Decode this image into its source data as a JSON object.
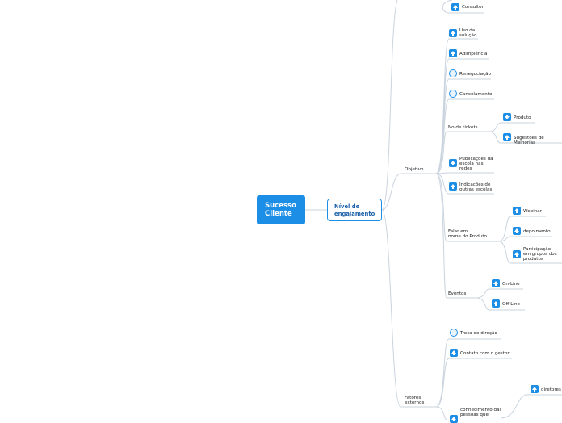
{
  "root": "Sucesso\nCliente",
  "main": "Nível de\nengajamento",
  "branches": {
    "objetivo": "Objetivo",
    "fatores": "Fatores\nexternos"
  },
  "items": {
    "consultor": "Consultor",
    "uso": "Uso da\nsolução",
    "adimplencia": "Adimplência",
    "renegociacao": "Renegociação",
    "cancelamento": "Cancelamento",
    "tickets": "No de tickets",
    "produto": "Produto",
    "sugestoes": "Sugestões de Melhorias",
    "publicacoes": "Publicações da\nescola nas\nredes",
    "indicacoes": "Indicações de\noutras escolas",
    "falar": "Falar em\nnome do Produto",
    "webinar": "Webinar",
    "depoimento": "depoimento",
    "participacao": "Participação\nem grupos dos\nprodutos",
    "eventos": "Eventos",
    "online": "On-Line",
    "offline": "Off-Line",
    "troca": "Troca de direção",
    "contato": "Contato com o gestor",
    "conhecimento": "conhecimento das\npessoas que",
    "diretores": "diretores"
  },
  "icons": {
    "consultor": "arrow-up-icon",
    "uso": "arrow-up-icon",
    "adimplencia": "arrow-up-icon",
    "renegociacao": "circle-icon",
    "cancelamento": "circle-icon",
    "produto": "arrow-down-icon",
    "sugestoes": "arrow-up-icon",
    "publicacoes": "arrow-up-icon",
    "indicacoes": "arrow-up-icon",
    "webinar": "arrow-up-icon",
    "depoimento": "arrow-up-icon",
    "participacao": "arrow-up-icon",
    "online": "arrow-up-icon",
    "offline": "arrow-up-icon",
    "troca": "circle-icon",
    "contato": "arrow-up-icon",
    "conhecimento": "arrow-up-icon",
    "diretores": "arrow-up-icon"
  },
  "colors": {
    "accent": "#1d8ee6",
    "connector": "#c9d3de",
    "text": "#1a1a1a"
  }
}
